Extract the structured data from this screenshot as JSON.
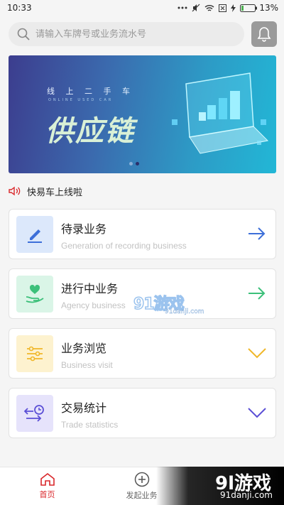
{
  "status_bar": {
    "time": "10:33",
    "battery": "13%"
  },
  "search": {
    "placeholder": "请输入车牌号或业务流水号"
  },
  "banner": {
    "subtitle": "线 上 二 手 车",
    "subtitle_en": "ONLINE USED CAR",
    "title": "供应链",
    "page_count": 2,
    "active_page": 2
  },
  "notice": {
    "text": "快易车上线啦"
  },
  "cards": [
    {
      "title": "待录业务",
      "subtitle": "Generation of recording business",
      "icon": "pencil-icon",
      "icon_bg": "#dce8fb",
      "icon_color": "#3d6fd9",
      "arrow": "arrow-right-icon",
      "arrow_color": "#3d6fd9"
    },
    {
      "title": "进行中业务",
      "subtitle": "Agency business",
      "icon": "heart-hand-icon",
      "icon_bg": "#daf5e7",
      "icon_color": "#3cc07a",
      "arrow": "arrow-right-icon",
      "arrow_color": "#3cc07a"
    },
    {
      "title": "业务浏览",
      "subtitle": "Business visit",
      "icon": "sliders-icon",
      "icon_bg": "#fdf2cf",
      "icon_color": "#f0b72a",
      "arrow": "chevron-down-icon",
      "arrow_color": "#f0b72a"
    },
    {
      "title": "交易统计",
      "subtitle": "Trade statistics",
      "icon": "clock-exchange-icon",
      "icon_bg": "#e6e3fb",
      "icon_color": "#5b4fd6",
      "arrow": "chevron-down-icon",
      "arrow_color": "#5b4fd6"
    }
  ],
  "watermark": {
    "logo": "91游戏",
    "url": "91danji.com"
  },
  "tabbar": {
    "items": [
      {
        "label": "首页",
        "icon": "home-icon",
        "active": true
      },
      {
        "label": "发起业务",
        "icon": "plus-circle-icon",
        "active": false
      }
    ]
  },
  "brand": {
    "logo": "9l游戏",
    "url": "91danji.com"
  },
  "colors": {
    "accent": "#d9262a",
    "background": "#f5f5f5"
  }
}
